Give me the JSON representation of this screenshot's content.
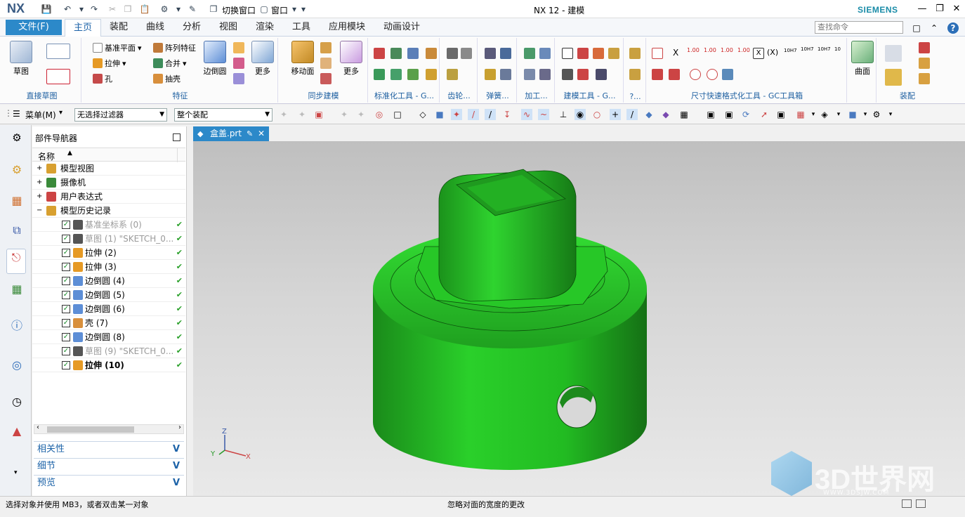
{
  "app": {
    "logo": "NX",
    "title": "NX 12 - 建模",
    "brand": "SIEMENS",
    "switch_window": "切换窗口",
    "window_menu": "窗口"
  },
  "tabs": {
    "file": "文件(F)",
    "items": [
      "主页",
      "装配",
      "曲线",
      "分析",
      "视图",
      "渲染",
      "工具",
      "应用模块",
      "动画设计"
    ],
    "active": "主页"
  },
  "search": {
    "placeholder": "查找命令"
  },
  "ribbon": {
    "sketch": "草图",
    "group_direct_sketch": "直接草图",
    "datum_plane": "基准平面",
    "pattern_feature": "阵列特征",
    "extrude": "拉伸",
    "unite": "合并",
    "hole": "孔",
    "shell": "抽壳",
    "edge_blend": "边倒圆",
    "more": "更多",
    "group_feature": "特征",
    "move_face": "移动面",
    "group_sync": "同步建模",
    "group_std": "标准化工具 - G...",
    "group_gear": "齿轮...",
    "group_spring": "弹簧...",
    "group_machining": "加工...",
    "group_modeling_tools": "建模工具 - G...",
    "group_more": "?...",
    "group_dim": "尺寸快速格式化工具 - GC工具箱",
    "dim_labels": [
      "1.00",
      "1.00",
      "1.00",
      "1.00",
      "(X)",
      "10H7",
      "10H7",
      "10H7",
      "10"
    ],
    "surface": "曲面",
    "group_assembly": "装配"
  },
  "toolbar2": {
    "menu": "菜单(M)",
    "filter": "无选择过滤器",
    "scope": "整个装配"
  },
  "navigator": {
    "title": "部件导航器",
    "col_name": "名称",
    "rows": [
      {
        "label": "模型视图",
        "style": "normal",
        "check": false
      },
      {
        "label": "摄像机",
        "style": "normal",
        "check": false
      },
      {
        "label": "用户表达式",
        "style": "normal",
        "check": false
      },
      {
        "label": "模型历史记录",
        "style": "normal",
        "check": false
      },
      {
        "label": "基准坐标系 (0)",
        "style": "gray",
        "check": true
      },
      {
        "label": "草图 (1) \"SKETCH_0...",
        "style": "gray",
        "check": true
      },
      {
        "label": "拉伸 (2)",
        "style": "normal",
        "check": true
      },
      {
        "label": "拉伸 (3)",
        "style": "normal",
        "check": true
      },
      {
        "label": "边倒圆 (4)",
        "style": "normal",
        "check": true
      },
      {
        "label": "边倒圆 (5)",
        "style": "normal",
        "check": true
      },
      {
        "label": "边倒圆 (6)",
        "style": "normal",
        "check": true
      },
      {
        "label": "壳 (7)",
        "style": "normal",
        "check": true
      },
      {
        "label": "边倒圆 (8)",
        "style": "normal",
        "check": true
      },
      {
        "label": "草图 (9) \"SKETCH_0...",
        "style": "gray",
        "check": true
      },
      {
        "label": "拉伸 (10)",
        "style": "bold",
        "check": true
      }
    ],
    "panels": [
      "相关性",
      "细节",
      "预览"
    ]
  },
  "view": {
    "tab": "盒盖.prt",
    "axis_x": "X",
    "axis_y": "Y",
    "axis_z": "Z"
  },
  "status": {
    "left": "选择对象并使用 MB3，或者双击某一对象",
    "center": "忽略对面的宽度的更改"
  },
  "watermark": {
    "text": "3D世界网",
    "sub": "WWW.3DSJW.COM"
  },
  "colors": {
    "accent": "#2c89c9",
    "model": "#22bb22",
    "label": "#1d5fa0"
  }
}
